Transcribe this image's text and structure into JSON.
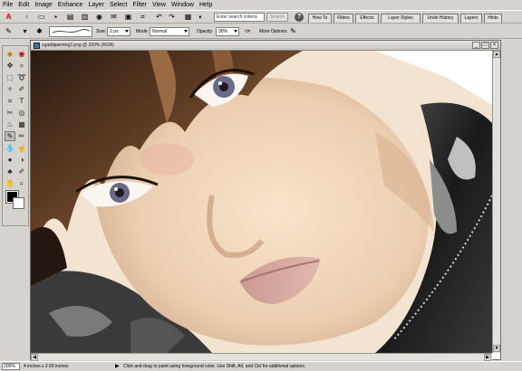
{
  "menu": [
    "File",
    "Edit",
    "Image",
    "Enhance",
    "Layer",
    "Select",
    "Filter",
    "View",
    "Window",
    "Help"
  ],
  "shortcuts": {
    "search_placeholder": "Enter search criteria",
    "search_button": "Search",
    "help_glyph": "?"
  },
  "palette_tabs": [
    "How To",
    "Filters",
    "Effects",
    "Layer Styles",
    "Undo History",
    "Layers",
    "Hints"
  ],
  "options": {
    "size_label": "Size:",
    "size_value": "2 px",
    "mode_label": "Mode:",
    "mode_value": "Normal",
    "opacity_label": "Opacity:",
    "opacity_value": "30%",
    "more_options_label": "More Options:"
  },
  "document": {
    "title": "cgaddpainting2.png @ 200% (RGB)",
    "minimize": "_",
    "maximize": "□",
    "close": "×"
  },
  "status": {
    "zoom": "200%",
    "doc_size": "4 inches x 2.69 inches",
    "arrow": "▶",
    "hint": "Click and drag to paint using foreground color.  Use Shift, Alt, and Ctrl for additional options."
  },
  "colors": {
    "foreground": "#000000",
    "background": "#ffffff"
  },
  "icons": {
    "adobe": "adobe-logo-icon",
    "new": "new-file-icon",
    "open": "open-file-icon",
    "save": "save-icon",
    "print": "print-icon",
    "email": "email-icon",
    "step_back": "step-backward-icon",
    "step_forward": "step-forward-icon",
    "brush": "brush-tool-icon",
    "airbrush": "airbrush-icon",
    "tablet": "tablet-options-icon"
  }
}
